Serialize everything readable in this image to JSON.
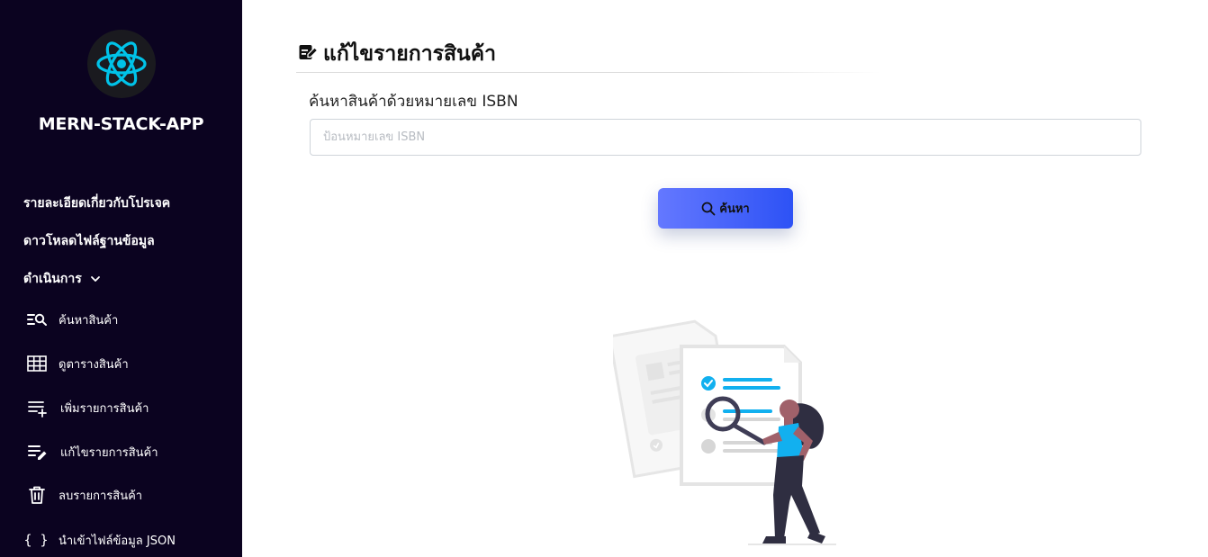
{
  "sidebar": {
    "app_title": "MERN-STACK-APP",
    "logo_icon": "react-atom-icon",
    "top_links": [
      {
        "label": "รายละเอียดเกี่ยวกับโปรเจค"
      },
      {
        "label": "ดาวโหลดไฟล์ฐานข้อมูล"
      },
      {
        "label": "ดำเนินการ",
        "icon": "chevron-down-icon"
      }
    ],
    "sub_items": [
      {
        "label": "ค้นหาสินค้า",
        "icon": "list-search-icon"
      },
      {
        "label": "ดูตารางสินค้า",
        "icon": "table-icon"
      },
      {
        "label": "เพิ่มรายการสินค้า",
        "icon": "playlist-add-icon"
      },
      {
        "label": "แก้ไขรายการสินค้า",
        "icon": "playlist-edit-icon"
      },
      {
        "label": "ลบรายการสินค้า",
        "icon": "trash-icon"
      },
      {
        "label": "นำเข้าไฟล์ข้อมูล JSON",
        "icon": "braces-icon",
        "glyph": "{ }"
      }
    ]
  },
  "main": {
    "title": "แก้ไขรายการสินค้า",
    "title_icon": "edit-note-icon",
    "search_label": "ค้นหาสินค้าด้วยหมายเลข ISBN",
    "search_placeholder": "ป้อนหมายเลข ISBN",
    "search_value": "",
    "search_button": "ค้นหา",
    "search_button_icon": "magnifier-icon",
    "illustration": "person-searching-documents-illustration"
  },
  "colors": {
    "sidebar_bg": "#0b0320",
    "accent_cyan": "#00c2e8",
    "button_gradient_start": "#6478ff",
    "button_gradient_end": "#2d52f5",
    "illustration_blue": "#12b0ef"
  }
}
